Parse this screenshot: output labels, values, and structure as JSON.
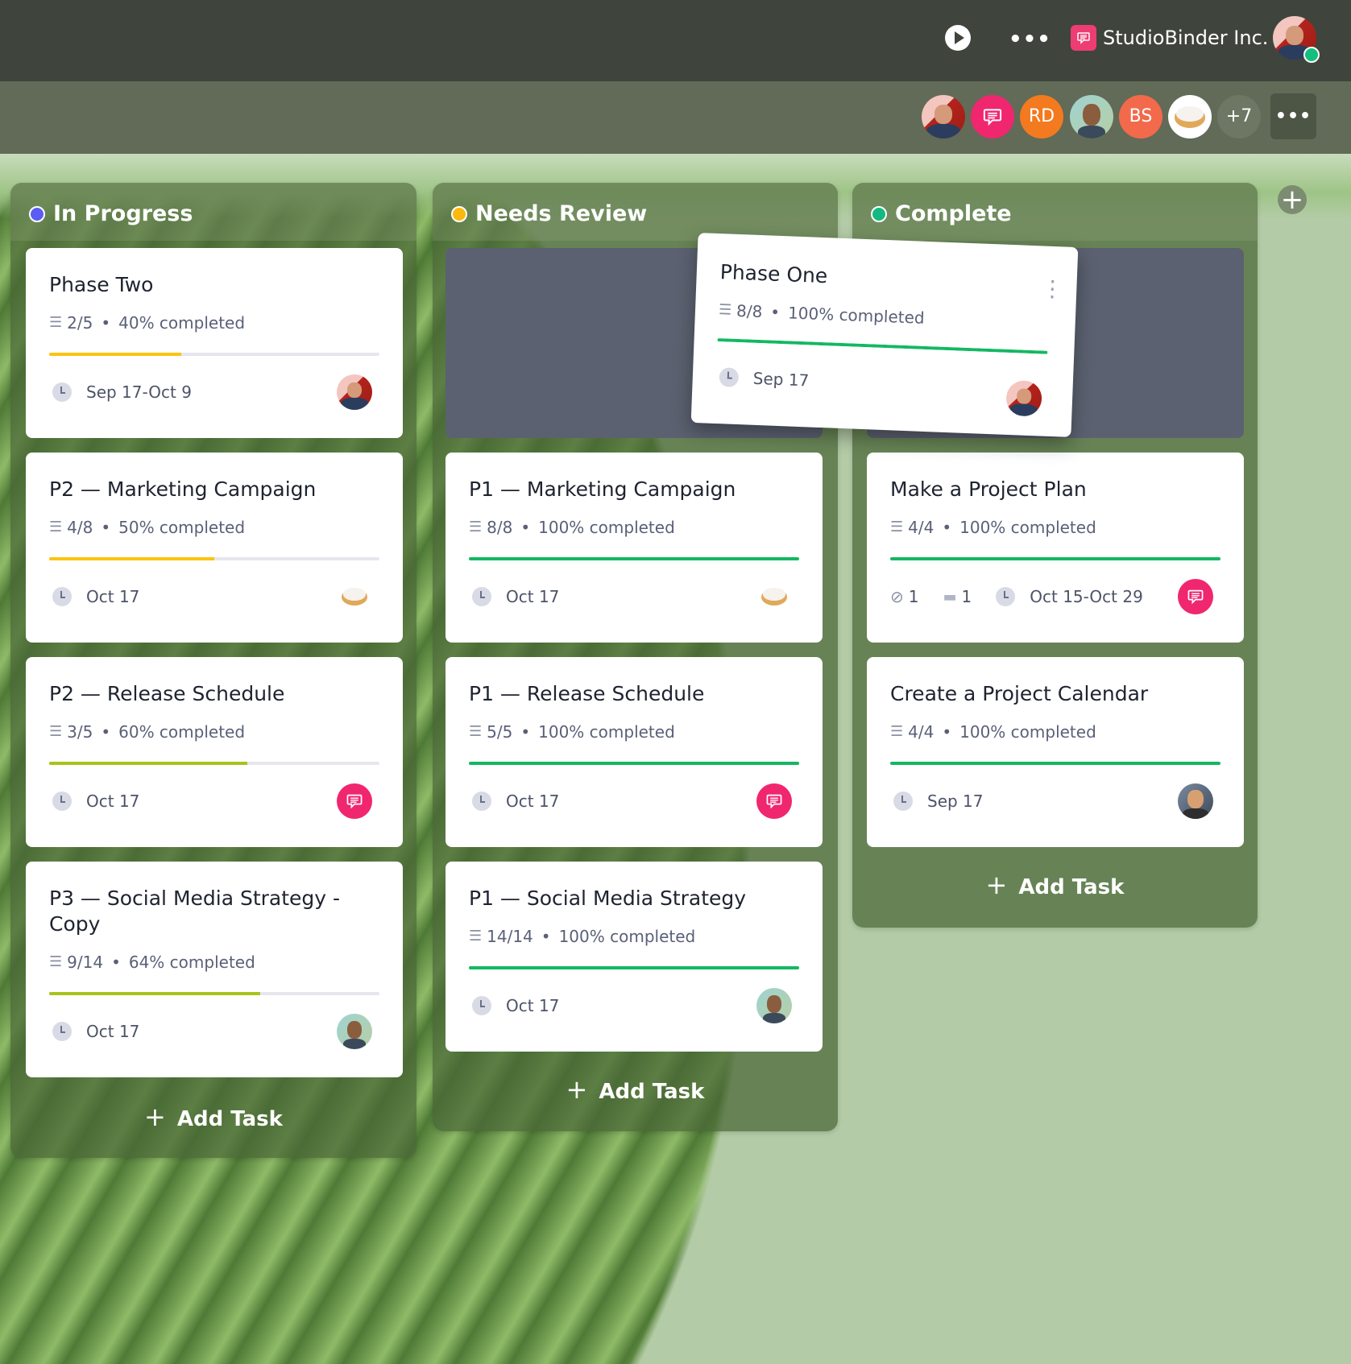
{
  "topbar": {
    "play_icon": "play-circle-icon",
    "more_icon": "ellipsis-icon",
    "more_label": "•••",
    "org_name": "StudioBinder Inc.",
    "org_logo_icon": "chat-bubble-icon",
    "user_status": "online"
  },
  "collaborators": {
    "avatars": [
      {
        "type": "photo",
        "name": "user-avatar-1"
      },
      {
        "type": "icon",
        "icon": "chat-bubble-icon",
        "color": "#f0266f"
      },
      {
        "type": "initials",
        "text": "RD",
        "color": "#f37a1f"
      },
      {
        "type": "photo",
        "name": "user-avatar-2"
      },
      {
        "type": "initials",
        "text": "BS",
        "color": "#f26a4b"
      },
      {
        "type": "photo",
        "name": "donut-avatar"
      }
    ],
    "overflow_count": "+7",
    "more_label": "•••"
  },
  "colors": {
    "in_progress": "#5c5cf5",
    "needs_review": "#fbb80f",
    "complete": "#14b981",
    "progress_yellow": "#fbc40f",
    "progress_lime": "#a8c41b",
    "progress_green": "#13b862",
    "pink_chat": "#f0266f"
  },
  "columns": [
    {
      "title": "In Progress",
      "add_task_label": "Add Task",
      "cards": [
        {
          "title": "Phase Two",
          "checklist": "2/5",
          "percent_label": "40% completed",
          "progress": 40,
          "date": "Sep 17-Oct 9",
          "assignee": "user-avatar-1"
        },
        {
          "title": "P2 — Marketing Campaign",
          "checklist": "4/8",
          "percent_label": "50% completed",
          "progress": 50,
          "date": "Oct 17",
          "assignee": "donut-avatar"
        },
        {
          "title": "P2 — Release Schedule",
          "checklist": "3/5",
          "percent_label": "60% completed",
          "progress": 60,
          "date": "Oct 17",
          "assignee": "chat-avatar"
        },
        {
          "title": "P3 — Social Media Strategy - Copy",
          "checklist": "9/14",
          "percent_label": "64% completed",
          "progress": 64,
          "date": "Oct 17",
          "assignee": "user-avatar-2"
        }
      ]
    },
    {
      "title": "Needs Review",
      "add_task_label": "Add Task",
      "cards": [
        {
          "title": "P1 — Marketing Campaign",
          "checklist": "8/8",
          "percent_label": "100% completed",
          "progress": 100,
          "date": "Oct 17",
          "assignee": "donut-avatar"
        },
        {
          "title": "P1 — Release Schedule",
          "checklist": "5/5",
          "percent_label": "100% completed",
          "progress": 100,
          "date": "Oct 17",
          "assignee": "chat-avatar"
        },
        {
          "title": "P1 — Social Media Strategy",
          "checklist": "14/14",
          "percent_label": "100% completed",
          "progress": 100,
          "date": "Oct 17",
          "assignee": "user-avatar-2"
        }
      ]
    },
    {
      "title": "Complete",
      "add_task_label": "Add Task",
      "cards": [
        {
          "title": "Make a Project Plan",
          "checklist": "4/4",
          "percent_label": "100% completed",
          "progress": 100,
          "attachments": "1",
          "comments": "1",
          "date": "Oct 15-Oct 29",
          "assignee": "chat-avatar"
        },
        {
          "title": "Create a Project Calendar",
          "checklist": "4/4",
          "percent_label": "100% completed",
          "progress": 100,
          "date": "Sep 17",
          "assignee": "user-avatar-3"
        }
      ]
    }
  ],
  "dragging_card": {
    "title": "Phase One",
    "checklist": "8/8",
    "percent_label": "100% completed",
    "progress": 100,
    "date": "Sep 17",
    "assignee": "user-avatar-1"
  },
  "add_column_label": "+"
}
